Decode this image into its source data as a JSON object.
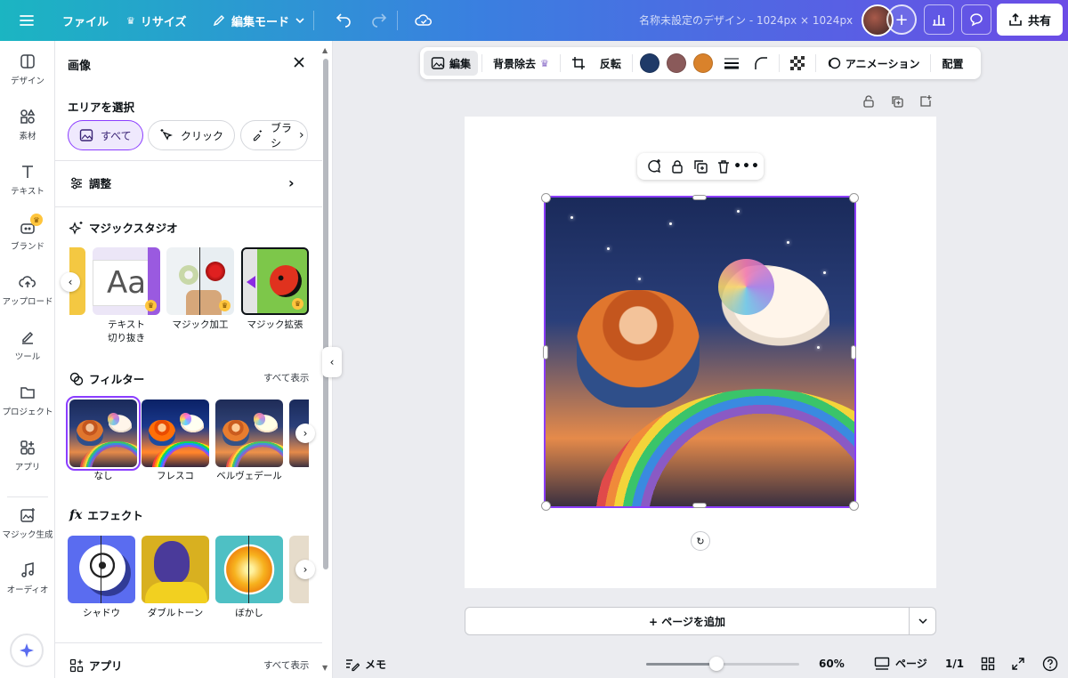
{
  "topbar": {
    "file_label": "ファイル",
    "resize_label": "リサイズ",
    "edit_mode_label": "編集モード",
    "doc_title": "名称未設定のデザイン - 1024px × 1024px",
    "share_label": "共有"
  },
  "rail": {
    "items": [
      {
        "label": "デザイン",
        "icon": "layout-icon"
      },
      {
        "label": "素材",
        "icon": "shapes-icon"
      },
      {
        "label": "テキスト",
        "icon": "text-icon"
      },
      {
        "label": "ブランド",
        "icon": "brand-icon"
      },
      {
        "label": "アップロード",
        "icon": "cloud-upload-icon"
      },
      {
        "label": "ツール",
        "icon": "pen-icon"
      },
      {
        "label": "プロジェクト",
        "icon": "folder-icon"
      },
      {
        "label": "アプリ",
        "icon": "apps-icon"
      },
      {
        "label": "マジック生成",
        "icon": "magic-image-icon"
      },
      {
        "label": "オーディオ",
        "icon": "music-icon"
      }
    ]
  },
  "panel": {
    "title": "画像",
    "select_area": {
      "title": "エリアを選択",
      "chips": [
        "すべて",
        "クリック",
        "ブラシ"
      ]
    },
    "adjust_label": "調整",
    "magic_studio": {
      "title": "マジックスタジオ",
      "tiles": [
        {
          "label": "テキスト\n切り抜き"
        },
        {
          "label": "マジック加工"
        },
        {
          "label": "マジック拡張"
        }
      ]
    },
    "filters": {
      "title": "フィルター",
      "see_all": "すべて表示",
      "tiles": [
        {
          "label": "なし"
        },
        {
          "label": "フレスコ"
        },
        {
          "label": "ベルヴェデール"
        }
      ]
    },
    "effects": {
      "title": "エフェクト",
      "tiles": [
        {
          "label": "シャドウ"
        },
        {
          "label": "ダブルトーン"
        },
        {
          "label": "ぼかし"
        }
      ]
    },
    "apps": {
      "title": "アプリ",
      "see_all": "すべて表示"
    }
  },
  "toolbar": {
    "edit_label": "編集",
    "bg_remove_label": "背景除去",
    "flip_label": "反転",
    "animation_label": "アニメーション",
    "position_label": "配置",
    "swatches": [
      "#1f3a68",
      "#8a5a5a",
      "#d9822b"
    ]
  },
  "canvas": {
    "add_page_label": "+ ページを追加"
  },
  "bottombar": {
    "memo_label": "メモ",
    "zoom_fraction": 0.46,
    "zoom_label": "60%",
    "pages_label": "ページ",
    "page_count": "1/1"
  }
}
